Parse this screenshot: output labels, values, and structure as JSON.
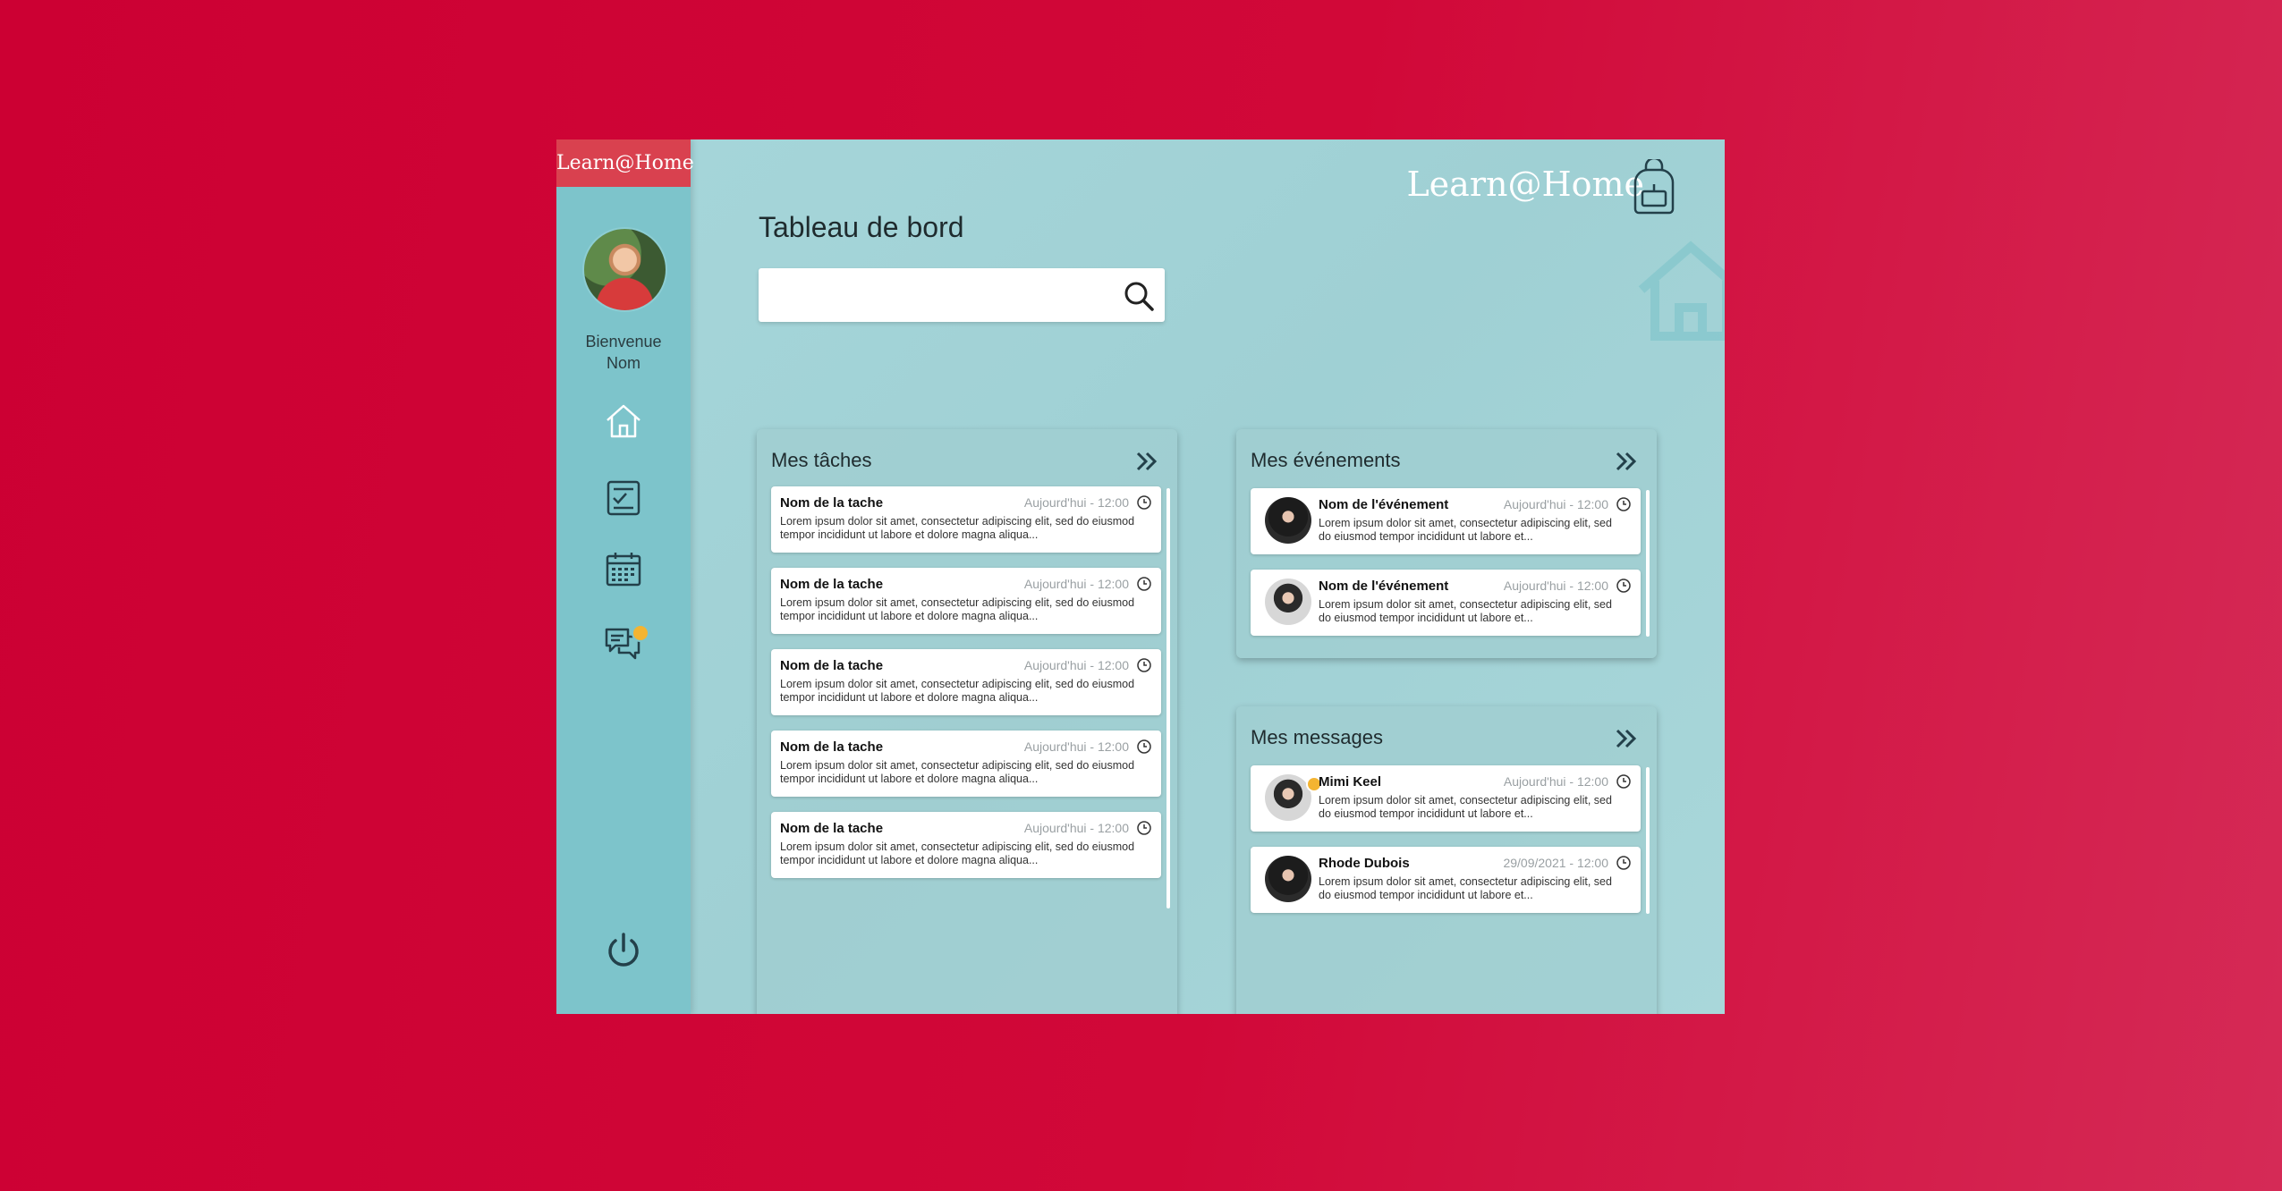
{
  "brand": {
    "name": "Learn@Home"
  },
  "sidebar": {
    "welcome_line1": "Bienvenue",
    "welcome_line2": "Nom",
    "nav": [
      {
        "icon": "home-icon"
      },
      {
        "icon": "tasks-icon"
      },
      {
        "icon": "calendar-icon"
      },
      {
        "icon": "messages-icon",
        "has_badge": true
      }
    ],
    "logout_icon": "power-icon"
  },
  "page": {
    "title": "Tableau de bord",
    "search_placeholder": ""
  },
  "tasks": {
    "title": "Mes tâches",
    "items": [
      {
        "name": "Nom de la tache",
        "time": "Aujourd'hui - 12:00",
        "desc": "Lorem ipsum dolor sit amet, consectetur adipiscing elit, sed do eiusmod tempor incididunt ut labore et dolore magna aliqua..."
      },
      {
        "name": "Nom de la tache",
        "time": "Aujourd'hui - 12:00",
        "desc": "Lorem ipsum dolor sit amet, consectetur adipiscing elit, sed do eiusmod tempor incididunt ut labore et dolore magna aliqua..."
      },
      {
        "name": "Nom de la tache",
        "time": "Aujourd'hui - 12:00",
        "desc": "Lorem ipsum dolor sit amet, consectetur adipiscing elit, sed do eiusmod tempor incididunt ut labore et dolore magna aliqua..."
      },
      {
        "name": "Nom de la tache",
        "time": "Aujourd'hui - 12:00",
        "desc": "Lorem ipsum dolor sit amet, consectetur adipiscing elit, sed do eiusmod tempor incididunt ut labore et dolore magna aliqua..."
      },
      {
        "name": "Nom de la tache",
        "time": "Aujourd'hui - 12:00",
        "desc": "Lorem ipsum dolor sit amet, consectetur adipiscing elit, sed do eiusmod tempor incididunt ut labore et dolore magna aliqua..."
      }
    ]
  },
  "events": {
    "title": "Mes événements",
    "items": [
      {
        "name": "Nom de l'événement",
        "time": "Aujourd'hui - 12:00",
        "desc": "Lorem ipsum dolor sit amet, consectetur adipiscing elit, sed do eiusmod tempor incididunt ut labore et..."
      },
      {
        "name": "Nom de l'événement",
        "time": "Aujourd'hui - 12:00",
        "desc": "Lorem ipsum dolor sit amet, consectetur adipiscing elit, sed do eiusmod tempor incididunt ut labore et..."
      }
    ]
  },
  "messages": {
    "title": "Mes messages",
    "items": [
      {
        "name": "Mimi Keel",
        "time": "Aujourd'hui - 12:00",
        "desc": "Lorem ipsum dolor sit amet, consectetur adipiscing elit, sed do eiusmod tempor incididunt ut labore et...",
        "unread": true
      },
      {
        "name": "Rhode Dubois",
        "time": "29/09/2021 - 12:00",
        "desc": "Lorem ipsum dolor sit amet, consectetur adipiscing elit, sed do eiusmod tempor incididunt ut labore et...",
        "unread": false
      }
    ]
  },
  "colors": {
    "background": "#cc0033",
    "sidebar": "#7dc4cb",
    "brand_tab": "#d9414f",
    "badge": "#f4b431"
  }
}
